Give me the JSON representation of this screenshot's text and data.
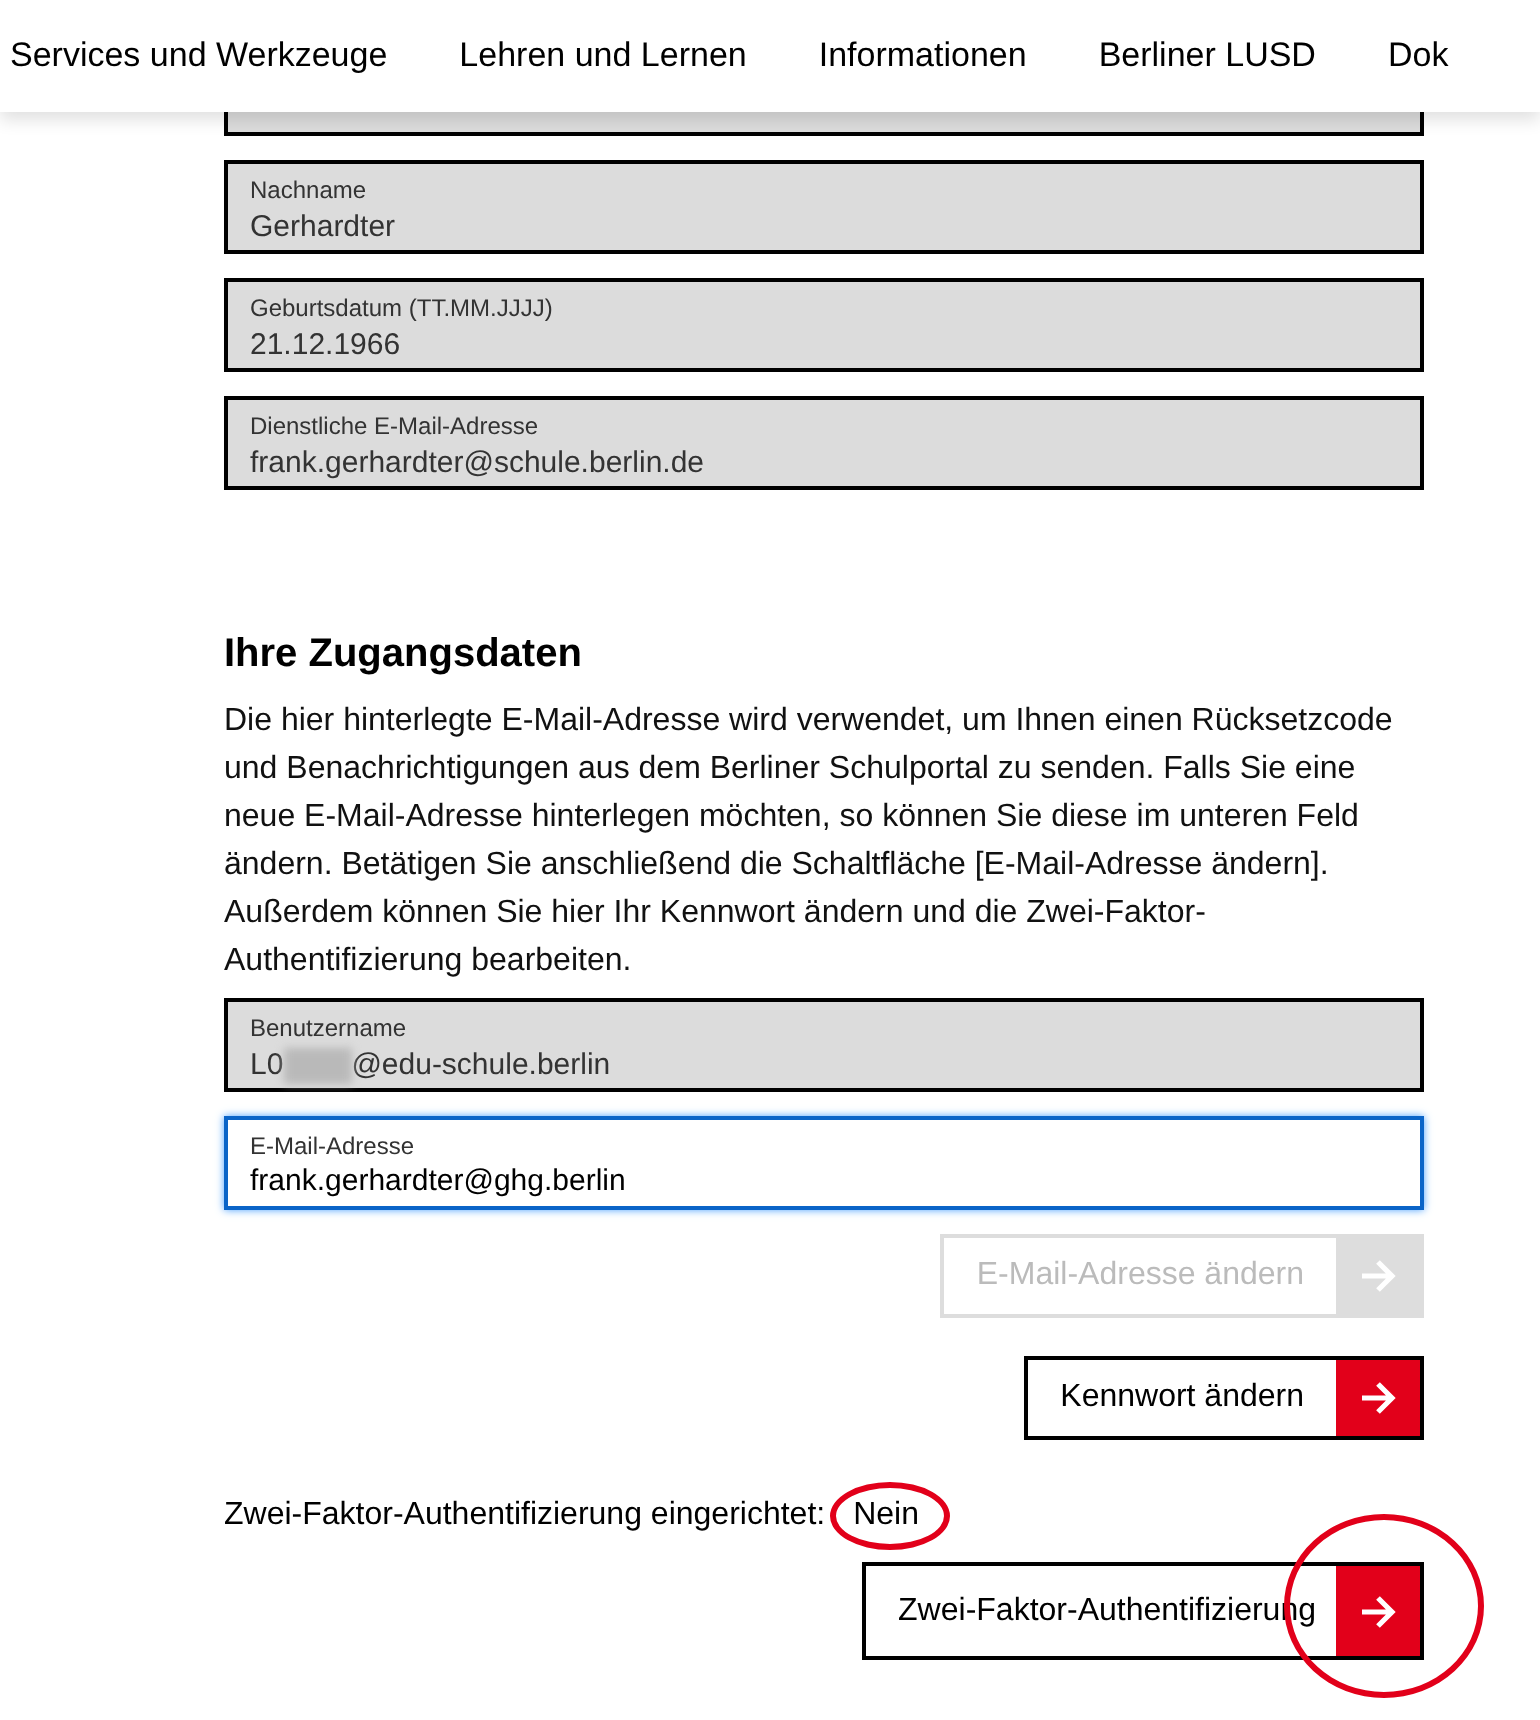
{
  "nav": {
    "items": [
      {
        "label": "Services und Werkzeuge"
      },
      {
        "label": "Lehren und Lernen"
      },
      {
        "label": "Informationen"
      },
      {
        "label": "Berliner LUSD"
      },
      {
        "label": "Dok"
      }
    ]
  },
  "personal_fields": [
    {
      "label": "Nachname",
      "value": "Gerhardter"
    },
    {
      "label": "Geburtsdatum (TT.MM.JJJJ)",
      "value": "21.12.1966"
    },
    {
      "label": "Dienstliche E-Mail-Adresse",
      "value": "frank.gerhardter@schule.berlin.de"
    }
  ],
  "section": {
    "title": "Ihre Zugangsdaten",
    "text": "Die hier hinterlegte E-Mail-Adresse wird verwendet, um Ihnen einen Rücksetzcode und Benachrichtigungen aus dem Berliner Schulportal zu senden. Falls Sie eine neue E-Mail-Adresse hinterlegen möchten, so können Sie diese im unteren Feld ändern. Betätigen Sie anschließend die Schaltfläche [E-Mail-Adresse ändern]. Außerdem können Sie hier Ihr Kennwort ändern und die Zwei-Faktor-Authentifizierung bearbeiten."
  },
  "username": {
    "label": "Benutzername",
    "prefix": "L0",
    "suffix": "@edu-schule.berlin",
    "redacted": true
  },
  "email": {
    "label": "E-Mail-Adresse",
    "value": "frank.gerhardter@ghg.berlin",
    "focused": true
  },
  "buttons": [
    {
      "label": "E-Mail-Adresse ändern",
      "disabled": true,
      "circled": false
    },
    {
      "label": "Kennwort ändern",
      "disabled": false,
      "circled": false
    }
  ],
  "two_factor": {
    "label": "Zwei-Faktor-Authentifizierung eingerichtet:",
    "value": "Nein",
    "circled": true
  },
  "two_factor_button": {
    "label": "Zwei-Faktor-Authentifizierung",
    "disabled": false,
    "circled": true
  }
}
